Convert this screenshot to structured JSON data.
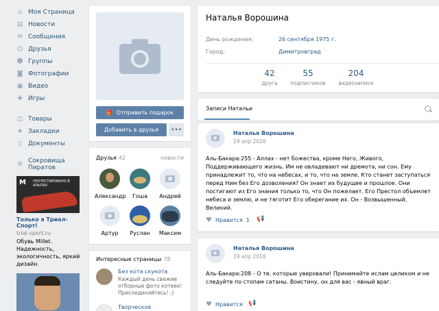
{
  "nav": {
    "items": [
      {
        "icon": "home-icon",
        "glyph": "⌂",
        "label": "Моя Страница"
      },
      {
        "icon": "news-icon",
        "glyph": "▤",
        "label": "Новости"
      },
      {
        "icon": "messages-icon",
        "glyph": "✉",
        "label": "Сообщения"
      },
      {
        "icon": "friends-icon",
        "glyph": "☺",
        "label": "Друзья"
      },
      {
        "icon": "groups-icon",
        "glyph": "☻",
        "label": "Группы"
      },
      {
        "icon": "photos-icon",
        "glyph": "◙",
        "label": "Фотографии"
      },
      {
        "icon": "video-icon",
        "glyph": "▣",
        "label": "Видео"
      },
      {
        "icon": "games-icon",
        "glyph": "✚",
        "label": "Игры"
      }
    ],
    "items2": [
      {
        "icon": "goods-icon",
        "glyph": "◫",
        "label": "Товары"
      },
      {
        "icon": "bookmarks-icon",
        "glyph": "★",
        "label": "Закладки"
      },
      {
        "icon": "documents-icon",
        "glyph": "▯",
        "label": "Документы"
      }
    ],
    "items3": [
      {
        "icon": "app-icon",
        "glyph": "⚙",
        "label": "Сокровища Пиратов"
      }
    ]
  },
  "ad": {
    "badge": "ПРОТЕСТИРОВАНО В АЛЬПАХ",
    "title": "Только в Триал-Спорт!",
    "domain": "trial-sport.ru",
    "desc": "Обувь Millet. Надежность, экологичность, яркий дизайн."
  },
  "profile": {
    "name": "Наталья Ворошина",
    "birthday_label": "День рождения:",
    "birthday_value": "26 сентября 1975 г.",
    "city_label": "Город:",
    "city_value": "Димитровград",
    "counters": [
      {
        "n": "42",
        "l": "друга"
      },
      {
        "n": "55",
        "l": "подписчиков"
      },
      {
        "n": "204",
        "l": "видеозаписи"
      }
    ]
  },
  "actions": {
    "gift": "Отправить подарок",
    "add_friend": "Добавить в друзья",
    "more": "•••"
  },
  "friends": {
    "title": "Друзья",
    "count": "42",
    "news": "новости",
    "list": [
      "Александр",
      "Гоша",
      "Андрей",
      "Артур",
      "Руслан",
      "Максим"
    ]
  },
  "interests": {
    "title": "Интересные страницы",
    "count": "78",
    "items": [
      {
        "title": "Без кота скукота",
        "desc": "Каждый день свежие отборные фото котеек! Присоединяйтесь! :)"
      },
      {
        "title": "Творческое",
        "desc": ""
      }
    ]
  },
  "wall": {
    "tab": "Записи Натальи"
  },
  "posts": [
    {
      "author": "Наталья Ворошина",
      "date": "19 апр 2016",
      "text": "Аль-Бакара:255 - Аллах - нет божества, кроме Него, Живого, Поддерживающего жизнь. Им не овладевают ни дремота, ни сон. Ему принадлежит то, что на небесах, и то, что на земле. Кто станет заступаться перед Ним без Его дозволения? Он знает их будущее и прошлое. Они постигают из Его знания только то, что Он пожелает. Его Престол объемлет небеса и землю, и не тяготит Его оберегание их. Он - Возвышенный, Великий.",
      "like_label": "Нравится",
      "like_count": "1"
    },
    {
      "author": "Наталья Ворошина",
      "date": "19 апр 2016",
      "text": "Аль-Бакара:208 - О те, которые уверовали! Принимайте ислам целиком и не следуйте по стопам сатаны. Воистину, он для вас - явный враг.",
      "like_label": "Нравится",
      "like_count": ""
    }
  ]
}
